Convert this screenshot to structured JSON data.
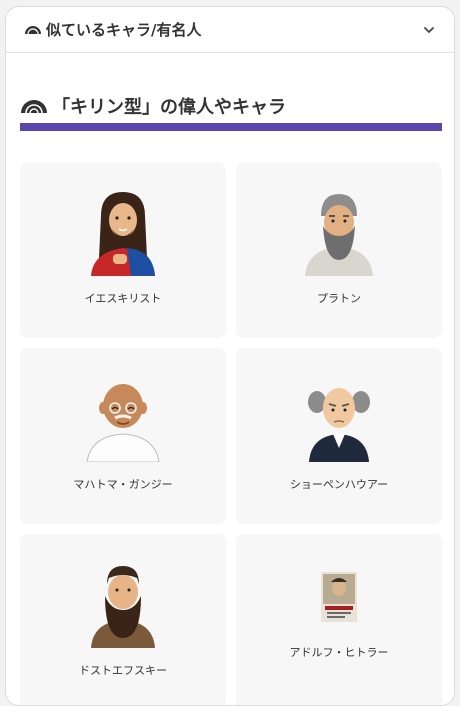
{
  "accordion": {
    "title": "似ているキャラ/有名人",
    "icon": "cloud-icon",
    "toggle_icon": "chevron-down-icon"
  },
  "section": {
    "title": "「キリン型」の偉人やキャラ",
    "accent_color": "#5b46b0"
  },
  "people": [
    {
      "name": "イエスキリスト",
      "icon": "jesus-illustration"
    },
    {
      "name": "プラトン",
      "icon": "plato-illustration"
    },
    {
      "name": "マハトマ・ガンジー",
      "icon": "gandhi-illustration"
    },
    {
      "name": "ショーペンハウアー",
      "icon": "schopenhauer-illustration"
    },
    {
      "name": "ドストエフスキー",
      "icon": "dostoevsky-illustration"
    },
    {
      "name": "アドルフ・ヒトラー",
      "icon": "hitler-photo"
    }
  ]
}
